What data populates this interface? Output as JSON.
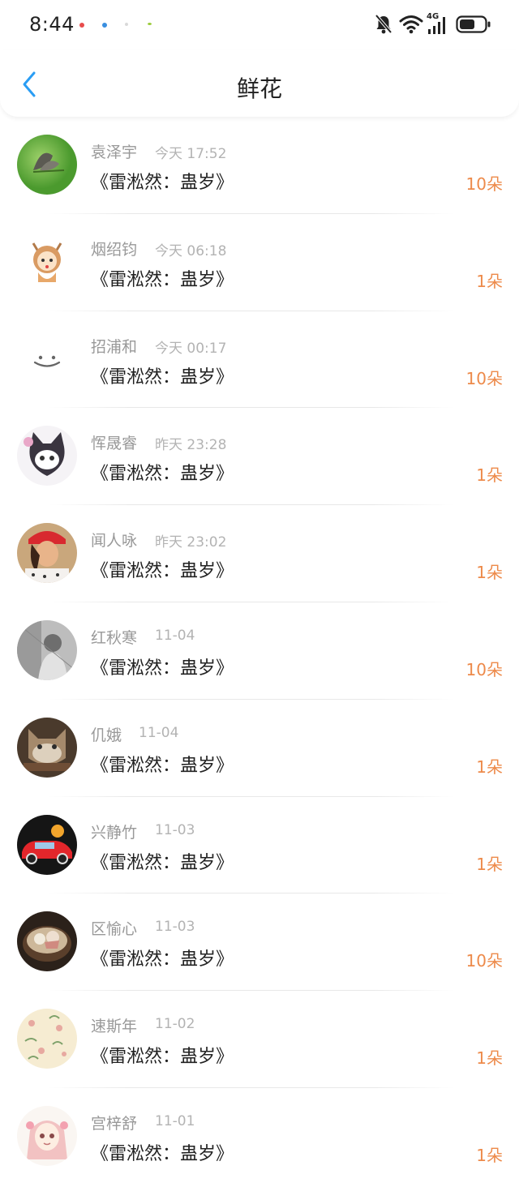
{
  "status_bar": {
    "time": "8:44",
    "notification_dot_colors": [
      "#e84c4c",
      "#3a8fe0",
      "#d9d9d9",
      "#9acb3a"
    ],
    "icons": [
      "mute-bell-icon",
      "wifi-icon",
      "signal-4g-icon",
      "battery-icon"
    ],
    "network_label": "4G"
  },
  "header": {
    "title": "鲜花",
    "back_icon": "chevron-left-icon",
    "accent_color": "#2a9df4"
  },
  "theme": {
    "count_color": "#ed8a4a",
    "name_color": "#999999",
    "time_color": "#b3b3b3"
  },
  "items": [
    {
      "name": "袁泽宇",
      "time": "今天 17:52",
      "title": "《雷淞然：蛊岁》",
      "count": "10朵"
    },
    {
      "name": "烟绍钧",
      "time": "今天 06:18",
      "title": "《雷淞然：蛊岁》",
      "count": "1朵"
    },
    {
      "name": "招浦和",
      "time": "今天 00:17",
      "title": "《雷淞然：蛊岁》",
      "count": "10朵"
    },
    {
      "name": "恽晟睿",
      "time": "昨天 23:28",
      "title": "《雷淞然：蛊岁》",
      "count": "1朵"
    },
    {
      "name": "闻人咏",
      "time": "昨天 23:02",
      "title": "《雷淞然：蛊岁》",
      "count": "1朵"
    },
    {
      "name": "红秋寒",
      "time": "11-04",
      "title": "《雷淞然：蛊岁》",
      "count": "10朵"
    },
    {
      "name": "仉娥",
      "time": "11-04",
      "title": "《雷淞然：蛊岁》",
      "count": "1朵"
    },
    {
      "name": "兴静竹",
      "time": "11-03",
      "title": "《雷淞然：蛊岁》",
      "count": "1朵"
    },
    {
      "name": "区愉心",
      "time": "11-03",
      "title": "《雷淞然：蛊岁》",
      "count": "10朵"
    },
    {
      "name": "速斯年",
      "time": "11-02",
      "title": "《雷淞然：蛊岁》",
      "count": "1朵"
    },
    {
      "name": "宫梓舒",
      "time": "11-01",
      "title": "《雷淞然：蛊岁》",
      "count": "1朵"
    }
  ]
}
